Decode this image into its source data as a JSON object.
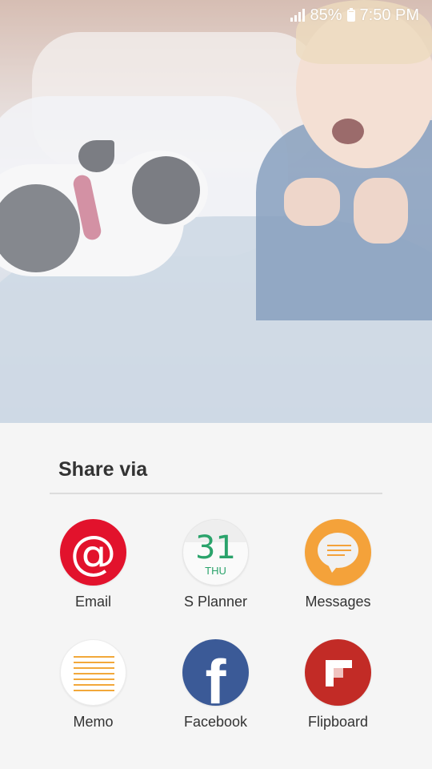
{
  "status_bar": {
    "battery": "85%",
    "time": "7:50 PM",
    "signal_icon": "signal-icon",
    "battery_icon": "battery-icon",
    "battery_level": 0.85
  },
  "share_sheet": {
    "title": "Share via",
    "apps": [
      {
        "label": "Email",
        "icon": "email-icon",
        "color": "#e2122c"
      },
      {
        "label": "S Planner",
        "icon": "calendar-icon",
        "date": "31",
        "weekday": "THU",
        "color": "#2aa36b"
      },
      {
        "label": "Messages",
        "icon": "messages-icon",
        "color": "#f4a23a"
      },
      {
        "label": "Memo",
        "icon": "memo-icon",
        "color": "#f2a83a"
      },
      {
        "label": "Facebook",
        "icon": "facebook-icon",
        "color": "#3b5a97"
      },
      {
        "label": "Flipboard",
        "icon": "flipboard-icon",
        "color": "#c22b26"
      }
    ]
  }
}
